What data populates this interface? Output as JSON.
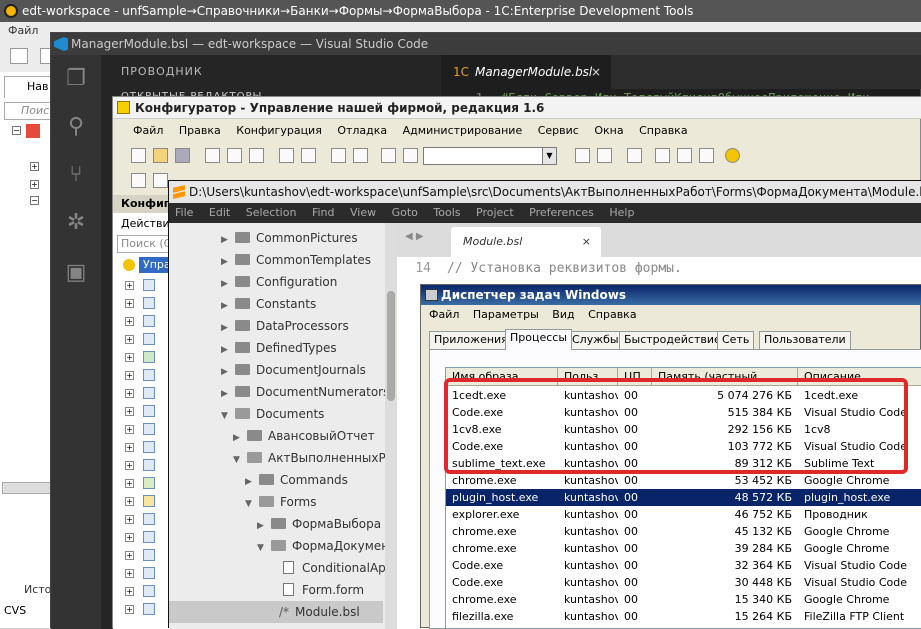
{
  "edt": {
    "title": "edt-workspace - unfSample→Справочники→Банки→Формы→ФормаВыбора - 1C:Enterprise Development Tools",
    "menu_file": "Файл",
    "nav_tab": "Нав",
    "search_placeholder": "Поиск",
    "bottom_tab": "Исто",
    "cvs_label": "CVS"
  },
  "vscode": {
    "title": "ManagerModule.bsl — edt-workspace — Visual Studio Code",
    "explorer_header": "ПРОВОДНИК",
    "open_editors": "ОТКРЫТЫЕ РЕДАКТОРЫ",
    "tab_label": "ManagerModule.bsl",
    "tab_close": "×",
    "tab_icon_text": "1С",
    "code_line_number": "1",
    "code_line_text": "#Если Сервер Или ТолстыйКлиентОбычноеПриложение Или"
  },
  "configurator": {
    "title": "Конфигуратор - Управление нашей фирмой, редакция 1.6",
    "menu": [
      "Файл",
      "Правка",
      "Конфигурация",
      "Отладка",
      "Администрирование",
      "Сервис",
      "Окна",
      "Справка"
    ],
    "pane_header": "Конфиг",
    "actions_label": "Действи",
    "search_placeholder": "Поиск (С",
    "selected_item": "Упра"
  },
  "sublime": {
    "title": "D:\\Users\\kuntashov\\edt-workspace\\unfSample\\src\\Documents\\АктВыполненныхРабот\\Forms\\ФормаДокумента\\Module.bsl",
    "menu": [
      "File",
      "Edit",
      "Selection",
      "Find",
      "View",
      "Goto",
      "Tools",
      "Project",
      "Preferences",
      "Help"
    ],
    "tree": [
      {
        "label": "CommonPictures",
        "depth": 0,
        "type": "folder",
        "expanded": false
      },
      {
        "label": "CommonTemplates",
        "depth": 0,
        "type": "folder",
        "expanded": false
      },
      {
        "label": "Configuration",
        "depth": 0,
        "type": "folder",
        "expanded": false
      },
      {
        "label": "Constants",
        "depth": 0,
        "type": "folder",
        "expanded": false
      },
      {
        "label": "DataProcessors",
        "depth": 0,
        "type": "folder",
        "expanded": false
      },
      {
        "label": "DefinedTypes",
        "depth": 0,
        "type": "folder",
        "expanded": false
      },
      {
        "label": "DocumentJournals",
        "depth": 0,
        "type": "folder",
        "expanded": false
      },
      {
        "label": "DocumentNumerators",
        "depth": 0,
        "type": "folder",
        "expanded": false
      },
      {
        "label": "Documents",
        "depth": 0,
        "type": "folder",
        "expanded": true
      },
      {
        "label": "АвансовыйОтчет",
        "depth": 1,
        "type": "folder",
        "expanded": false
      },
      {
        "label": "АктВыполненныхРаб",
        "depth": 1,
        "type": "folder",
        "expanded": true
      },
      {
        "label": "Commands",
        "depth": 2,
        "type": "folder",
        "expanded": false
      },
      {
        "label": "Forms",
        "depth": 2,
        "type": "folder",
        "expanded": true
      },
      {
        "label": "ФормаВыбора",
        "depth": 3,
        "type": "folder",
        "expanded": false
      },
      {
        "label": "ФормаДокумент",
        "depth": 3,
        "type": "folder",
        "expanded": true
      },
      {
        "label": "ConditionalAp",
        "depth": 4,
        "type": "file"
      },
      {
        "label": "Form.form",
        "depth": 4,
        "type": "file"
      },
      {
        "label": "Module.bsl",
        "depth": 4,
        "type": "code",
        "current": true
      }
    ],
    "code_prefix": "/*",
    "tab_label": "Module.bsl",
    "tab_close": "×",
    "line_number": "14",
    "line_text": "// Установка реквизитов формы."
  },
  "taskmgr": {
    "title": "Диспетчер задач Windows",
    "menu": [
      "Файл",
      "Параметры",
      "Вид",
      "Справка"
    ],
    "tabs": [
      "Приложения",
      "Процессы",
      "Службы",
      "Быстродействие",
      "Сеть",
      "Пользователи"
    ],
    "active_tab": "Процессы",
    "columns": [
      "Имя образа",
      "Польз...",
      "ЦП",
      "Память (частный ...",
      "Описание"
    ],
    "rows": [
      {
        "name": "1cedt.exe",
        "user": "kuntashov",
        "cpu": "00",
        "mem": "5 074 276 КБ",
        "desc": "1cedt.exe"
      },
      {
        "name": "Code.exe",
        "user": "kuntashov",
        "cpu": "00",
        "mem": "515 384 КБ",
        "desc": "Visual Studio Code"
      },
      {
        "name": "1cv8.exe",
        "user": "kuntashov",
        "cpu": "00",
        "mem": "292 156 КБ",
        "desc": "1cv8"
      },
      {
        "name": "Code.exe",
        "user": "kuntashov",
        "cpu": "00",
        "mem": "103 772 КБ",
        "desc": "Visual Studio Code"
      },
      {
        "name": "sublime_text.exe",
        "user": "kuntashov",
        "cpu": "00",
        "mem": "89 312 КБ",
        "desc": "Sublime Text"
      },
      {
        "name": "chrome.exe",
        "user": "kuntashov",
        "cpu": "00",
        "mem": "53 452 КБ",
        "desc": "Google Chrome"
      },
      {
        "name": "plugin_host.exe",
        "user": "kuntashov",
        "cpu": "00",
        "mem": "48 572 КБ",
        "desc": "plugin_host.exe",
        "selected": true
      },
      {
        "name": "explorer.exe",
        "user": "kuntashov",
        "cpu": "00",
        "mem": "46 752 КБ",
        "desc": "Проводник"
      },
      {
        "name": "chrome.exe",
        "user": "kuntashov",
        "cpu": "00",
        "mem": "45 132 КБ",
        "desc": "Google Chrome"
      },
      {
        "name": "chrome.exe",
        "user": "kuntashov",
        "cpu": "00",
        "mem": "39 284 КБ",
        "desc": "Google Chrome"
      },
      {
        "name": "Code.exe",
        "user": "kuntashov",
        "cpu": "00",
        "mem": "32 364 КБ",
        "desc": "Visual Studio Code"
      },
      {
        "name": "Code.exe",
        "user": "kuntashov",
        "cpu": "00",
        "mem": "30 448 КБ",
        "desc": "Visual Studio Code"
      },
      {
        "name": "chrome.exe",
        "user": "kuntashov",
        "cpu": "00",
        "mem": "15 340 КБ",
        "desc": "Google Chrome"
      },
      {
        "name": "filezilla.exe",
        "user": "kuntashov",
        "cpu": "00",
        "mem": "15 264 КБ",
        "desc": "FileZilla FTP Client"
      }
    ],
    "highlight_color": "#e0272a",
    "selection_color": "#0a246a"
  }
}
